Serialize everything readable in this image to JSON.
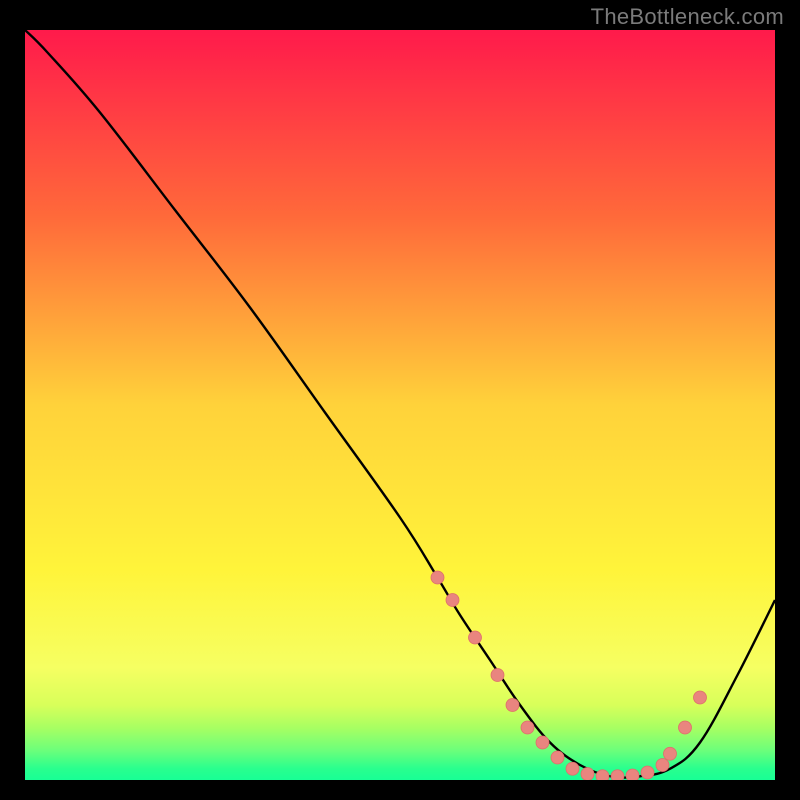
{
  "watermark": {
    "text": "TheBottleneck.com"
  },
  "colors": {
    "background": "#000000",
    "curve_stroke": "#000000",
    "marker_fill": "#e9857f",
    "marker_stroke": "#de6f6a",
    "gradient_stops": [
      {
        "offset": 0.0,
        "color": "#ff1a4b"
      },
      {
        "offset": 0.25,
        "color": "#ff6a3a"
      },
      {
        "offset": 0.5,
        "color": "#ffd23a"
      },
      {
        "offset": 0.72,
        "color": "#fff43a"
      },
      {
        "offset": 0.85,
        "color": "#f6ff62"
      },
      {
        "offset": 0.9,
        "color": "#d8ff5a"
      },
      {
        "offset": 0.93,
        "color": "#a8ff62"
      },
      {
        "offset": 0.96,
        "color": "#6dff7a"
      },
      {
        "offset": 0.985,
        "color": "#29ff8e"
      },
      {
        "offset": 1.0,
        "color": "#18ff95"
      }
    ]
  },
  "chart_data": {
    "type": "line",
    "title": "",
    "xlabel": "",
    "ylabel": "",
    "x": [
      0,
      3,
      10,
      20,
      30,
      40,
      50,
      55,
      58,
      62,
      66,
      70,
      74,
      78,
      82,
      86,
      90,
      95,
      100
    ],
    "values": [
      100,
      97,
      89,
      76,
      63,
      49,
      35,
      27,
      22,
      16,
      10,
      5,
      2,
      0.5,
      0.5,
      1.5,
      5,
      14,
      24
    ],
    "xlim": [
      0,
      100
    ],
    "ylim": [
      0,
      100
    ],
    "markers_x": [
      55,
      57,
      60,
      63,
      65,
      67,
      69,
      71,
      73,
      75,
      77,
      79,
      81,
      83,
      85,
      86,
      88,
      90
    ],
    "markers_y": [
      27,
      24,
      19,
      14,
      10,
      7,
      5,
      3,
      1.5,
      0.8,
      0.5,
      0.5,
      0.6,
      1,
      2,
      3.5,
      7,
      11
    ]
  }
}
